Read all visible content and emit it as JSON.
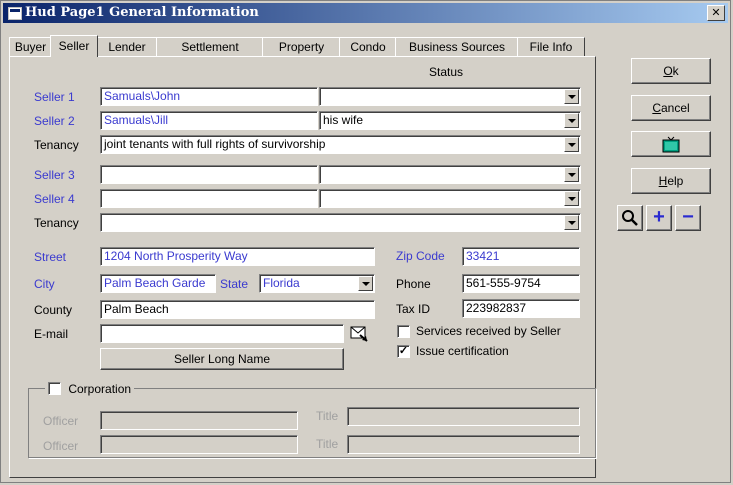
{
  "window": {
    "title": "Hud Page1 General Information",
    "close_glyph": "✕"
  },
  "tabs": [
    "Buyer",
    "Seller",
    "Lender",
    "Settlement",
    "Property",
    "Condo",
    "Business Sources",
    "File Info"
  ],
  "status_header": "Status",
  "sellers": {
    "seller1": {
      "label": "Seller 1",
      "name": "Samuals\\John",
      "status": ""
    },
    "seller2": {
      "label": "Seller 2",
      "name": "Samuals\\Jill",
      "status": "his wife"
    },
    "tenancy1": {
      "label": "Tenancy",
      "value": "joint tenants with full rights of survivorship"
    },
    "seller3": {
      "label": "Seller 3",
      "name": "",
      "status": ""
    },
    "seller4": {
      "label": "Seller 4",
      "name": "",
      "status": ""
    },
    "tenancy2": {
      "label": "Tenancy",
      "value": ""
    }
  },
  "address": {
    "street_label": "Street",
    "street": "1204 North Prosperity Way",
    "city_label": "City",
    "city": "Palm Beach Garde",
    "state_label": "State",
    "state": "Florida",
    "county_label": "County",
    "county": "Palm Beach",
    "email_label": "E-mail",
    "email": "",
    "zip_label": "Zip Code",
    "zip": "33421",
    "phone_label": "Phone",
    "phone": "561-555-9754",
    "taxid_label": "Tax ID",
    "taxid": "223982837"
  },
  "checks": {
    "services_label": "Services received by Seller",
    "services_checked": false,
    "issue_label": "Issue certification",
    "issue_checked": true
  },
  "long_name_button": "Seller Long Name",
  "corporation": {
    "label": "Corporation",
    "checked": false,
    "officer_label": "Officer",
    "title_label": "Title",
    "rows": [
      {
        "officer": "",
        "title": ""
      },
      {
        "officer": "",
        "title": ""
      }
    ]
  },
  "side_buttons": {
    "ok_prefix": "O",
    "ok_rest": "k",
    "cancel_prefix": "C",
    "cancel_rest": "ancel",
    "help_prefix": "H",
    "help_rest": "elp"
  },
  "zoom": {
    "plus": "+",
    "minus": "−"
  },
  "colors": {
    "label_blue": "#3a3acf",
    "title_start": "#0a246a",
    "title_end": "#a6caf0",
    "face": "#d4d0c8"
  }
}
